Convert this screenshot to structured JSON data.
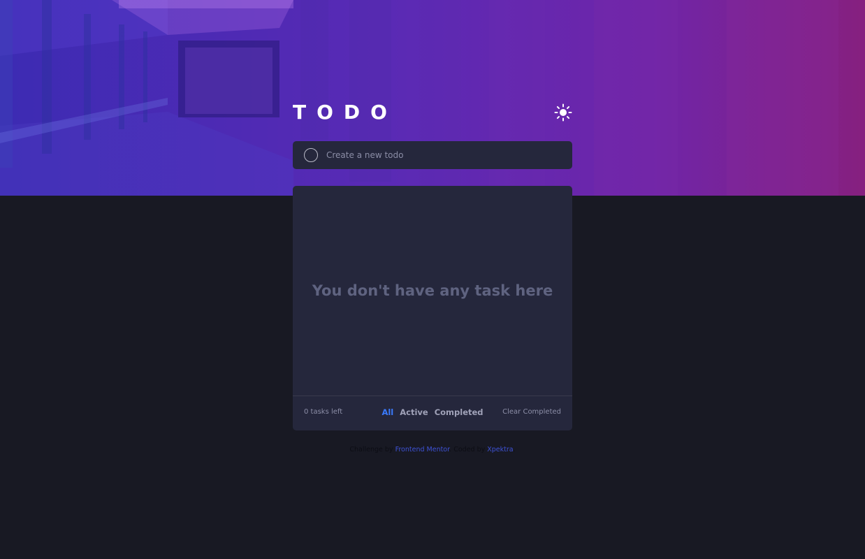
{
  "app": {
    "title": "TODO",
    "theme_toggle_icon": "sun-icon"
  },
  "new_todo": {
    "placeholder": "Create a new todo",
    "value": ""
  },
  "list": {
    "empty_message": "You don't have any task here"
  },
  "footer": {
    "items_left": "0 tasks left",
    "filters": [
      "All",
      "Active",
      "Completed"
    ],
    "active_filter": "All",
    "clear_label": "Clear Completed"
  },
  "attribution": {
    "prefix": "Challenge by",
    "link1": "Frontend Mentor",
    "middle": ". Coded by",
    "link2": "Xpektra",
    "suffix": "."
  },
  "colors": {
    "page_bg": "#181923",
    "card_bg": "#25273c",
    "accent": "#3a7bfd",
    "hero_left": "#3c2bb3",
    "hero_right": "#86207f"
  }
}
